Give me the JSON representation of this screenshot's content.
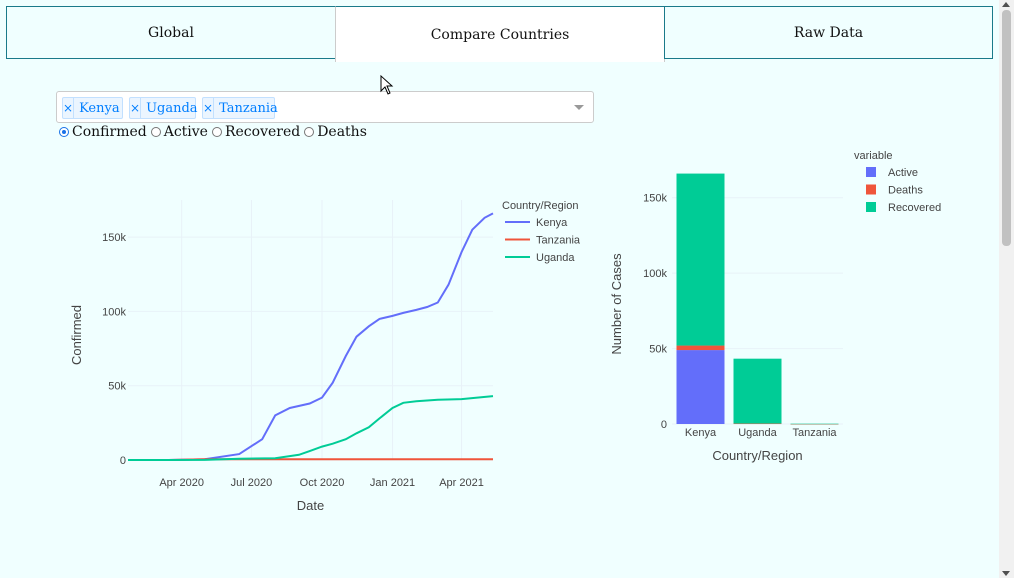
{
  "tabs": [
    {
      "label": "Global",
      "active": false
    },
    {
      "label": "Compare Countries",
      "active": true
    },
    {
      "label": "Raw Data",
      "active": false
    }
  ],
  "country_selector": {
    "selected": [
      "Kenya",
      "Uganda",
      "Tanzania"
    ],
    "remove_glyph": "×",
    "icon": "chevron-down-icon"
  },
  "metric_options": {
    "options": [
      "Confirmed",
      "Active",
      "Recovered",
      "Deaths"
    ],
    "selected": "Confirmed"
  },
  "chart_data": [
    {
      "type": "line",
      "xlabel": "Date",
      "ylabel": "Confirmed",
      "legend_title": "Country/Region",
      "legend_position": "top-right",
      "x_tick_labels": [
        "Apr 2020",
        "Jul 2020",
        "Oct 2020",
        "Jan 2021",
        "Apr 2021"
      ],
      "y_tick_labels": [
        "0",
        "50k",
        "100k",
        "150k"
      ],
      "ylim": [
        0,
        175000
      ],
      "xlim": [
        "2020-01-22",
        "2021-05-12"
      ],
      "series": [
        {
          "name": "Kenya",
          "color": "#636efa",
          "x": [
            "2020-01-22",
            "2020-03-15",
            "2020-05-01",
            "2020-06-15",
            "2020-07-15",
            "2020-08-01",
            "2020-08-20",
            "2020-09-15",
            "2020-10-01",
            "2020-10-15",
            "2020-11-01",
            "2020-11-15",
            "2020-12-01",
            "2020-12-15",
            "2021-01-01",
            "2021-01-15",
            "2021-02-01",
            "2021-02-15",
            "2021-03-01",
            "2021-03-15",
            "2021-04-01",
            "2021-04-15",
            "2021-05-01",
            "2021-05-12"
          ],
          "y": [
            0,
            0,
            500,
            4000,
            14000,
            30000,
            35000,
            38000,
            42000,
            52000,
            70000,
            83000,
            90000,
            95000,
            97000,
            99000,
            101000,
            103000,
            106000,
            118000,
            140000,
            155000,
            163000,
            166000
          ]
        },
        {
          "name": "Tanzania",
          "color": "#ef553b",
          "x": [
            "2020-01-22",
            "2020-03-15",
            "2020-05-01",
            "2021-05-12"
          ],
          "y": [
            0,
            0,
            509,
            509
          ]
        },
        {
          "name": "Uganda",
          "color": "#00cc96",
          "x": [
            "2020-01-22",
            "2020-03-15",
            "2020-05-01",
            "2020-06-15",
            "2020-08-01",
            "2020-09-01",
            "2020-09-15",
            "2020-10-01",
            "2020-10-15",
            "2020-11-01",
            "2020-11-15",
            "2020-12-01",
            "2020-12-15",
            "2021-01-01",
            "2021-01-15",
            "2021-02-01",
            "2021-03-01",
            "2021-04-01",
            "2021-05-12"
          ],
          "y": [
            0,
            0,
            100,
            800,
            1200,
            3500,
            6000,
            9000,
            11000,
            14000,
            18000,
            22000,
            28000,
            35000,
            38500,
            39500,
            40500,
            41000,
            43000
          ]
        }
      ]
    },
    {
      "type": "bar",
      "stacked": true,
      "xlabel": "Country/Region",
      "ylabel": "Number of Cases",
      "legend_title": "variable",
      "legend_position": "top-right",
      "categories": [
        "Kenya",
        "Uganda",
        "Tanzania"
      ],
      "y_tick_labels": [
        "0",
        "50k",
        "100k",
        "150k"
      ],
      "ylim": [
        0,
        175000
      ],
      "series": [
        {
          "name": "Active",
          "color": "#636efa",
          "values": [
            49000,
            0,
            0
          ]
        },
        {
          "name": "Deaths",
          "color": "#ef553b",
          "values": [
            3000,
            300,
            21
          ]
        },
        {
          "name": "Recovered",
          "color": "#00cc96",
          "values": [
            114000,
            43000,
            183
          ]
        }
      ]
    }
  ]
}
